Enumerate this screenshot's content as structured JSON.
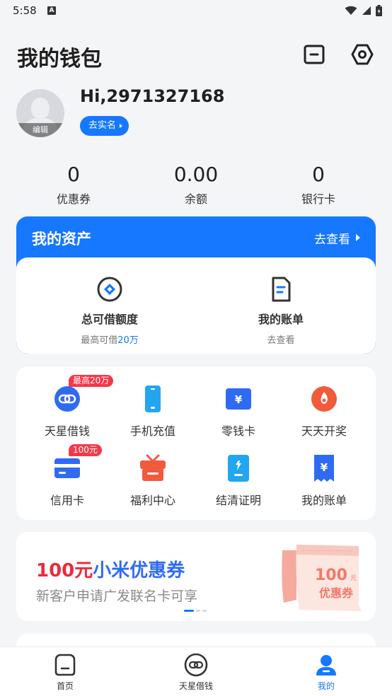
{
  "status_bar": {
    "time": "5:58",
    "indicator": "A"
  },
  "header": {
    "title": "我的钱包",
    "left_icon": "wallet-card-icon",
    "right_icon": "settings-hexagon-icon"
  },
  "profile": {
    "greeting": "Hi,2971327168",
    "avatar_edit": "编辑",
    "verify_label": "去实名"
  },
  "stats": [
    {
      "value": "0",
      "label": "优惠券"
    },
    {
      "value": "0.00",
      "label": "余额"
    },
    {
      "value": "0",
      "label": "银行卡"
    }
  ],
  "assets": {
    "title": "我的资产",
    "link": "去查看",
    "items": [
      {
        "title": "总可借额度",
        "sub_prefix": "最高可借",
        "sub_highlight": "20万",
        "icon": "credit-diamond-icon"
      },
      {
        "title": "我的账单",
        "sub_prefix": "去查看",
        "sub_highlight": "",
        "icon": "bill-document-icon"
      }
    ]
  },
  "services": [
    {
      "label": "天星借钱",
      "badge": "最高20万",
      "icon": "loan-link-icon",
      "color": "#2f6bf2"
    },
    {
      "label": "手机充值",
      "badge": "",
      "icon": "phone-icon",
      "color": "#22a6f0"
    },
    {
      "label": "零钱卡",
      "badge": "",
      "icon": "wallet-yen-icon",
      "color": "#2f6bf2"
    },
    {
      "label": "天天开奖",
      "badge": "",
      "icon": "lottery-icon",
      "color": "#f25a3c"
    },
    {
      "label": "信用卡",
      "badge": "100元",
      "icon": "credit-card-icon",
      "color": "#2f6bf2"
    },
    {
      "label": "福利中心",
      "badge": "",
      "icon": "gift-icon",
      "color": "#f25a3c"
    },
    {
      "label": "结清证明",
      "badge": "",
      "icon": "certificate-icon",
      "color": "#22a6f0"
    },
    {
      "label": "我的账单",
      "badge": "",
      "icon": "bill-yen-icon",
      "color": "#2f6bf2"
    }
  ],
  "promo": {
    "title_red": "100元",
    "title_blue": "小米优惠券",
    "subtitle": "新客户申请广发联名卡可享",
    "coupon_amount": "100",
    "coupon_unit": "元",
    "coupon_label": "优惠券"
  },
  "tabbar": [
    {
      "label": "首页",
      "icon": "home-icon",
      "active": false
    },
    {
      "label": "天星借钱",
      "icon": "loan-link-icon",
      "active": false
    },
    {
      "label": "我的",
      "icon": "profile-icon",
      "active": true
    }
  ],
  "colors": {
    "accent": "#1677ff",
    "badge": "#f5384a",
    "promo_red": "#ee2a3a"
  }
}
